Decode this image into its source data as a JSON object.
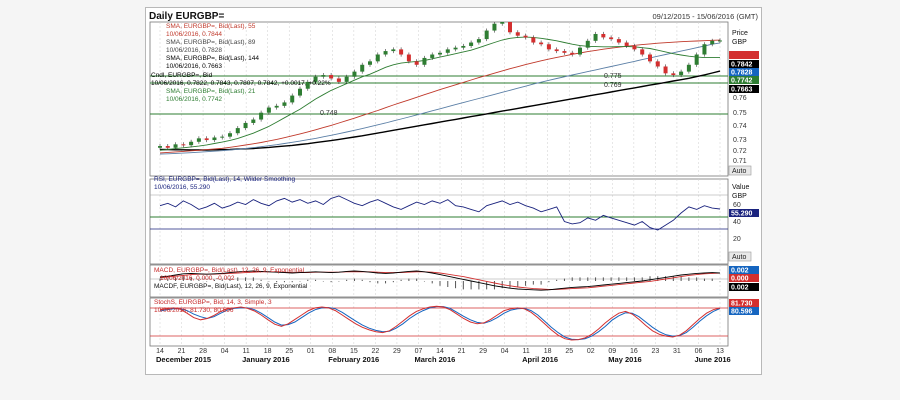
{
  "header": {
    "title": "Daily EURGBP=",
    "date_range": "09/12/2015 - 15/06/2016 (GMT)"
  },
  "price_axis": {
    "title_line1": "Price",
    "title_line2": "GBP",
    "ticks": [
      "0.76",
      "0.75",
      "0.74",
      "0.73",
      "0.72",
      "0.71"
    ],
    "auto": "Auto"
  },
  "value_axis": {
    "title_line1": "Value",
    "title_line2": "GBP",
    "ticks": [
      "60",
      "40",
      "20"
    ],
    "auto": "Auto"
  },
  "price_legend": [
    {
      "text": "SMA, EURGBP=, Bid(Last), 55",
      "color": "#c0392b"
    },
    {
      "text": "10/06/2016, 0.7844",
      "color": "#c0392b"
    },
    {
      "text": "SMA, EURGBP=, Bid(Last), 89",
      "color": "#444444"
    },
    {
      "text": "10/06/2016, 0.7828",
      "color": "#444444"
    },
    {
      "text": "SMA, EURGBP=, Bid(Last), 144",
      "color": "#000000"
    },
    {
      "text": "10/06/2016, 0.7663",
      "color": "#000000"
    },
    {
      "text": "Cndl, EURGBP=, Bid",
      "color": "#000000"
    },
    {
      "text": "10/06/2016, 0.7822, 0.7843, 0.7807, 0.7842, +0.0017, +0.22%",
      "color": "#000000"
    },
    {
      "text": "SMA, EURGBP=, Bid(Last), 21",
      "color": "#2e7d32"
    },
    {
      "text": "10/06/2016, 0.7742",
      "color": "#2e7d32"
    }
  ],
  "price_badges": [
    {
      "text": "0.7842",
      "bg": "#000000",
      "fg": "#ffffff"
    },
    {
      "text": "0.7828",
      "bg": "#1565c0",
      "fg": "#ffffff"
    },
    {
      "text": "0.7742",
      "bg": "#2e7d32",
      "fg": "#ffffff"
    },
    {
      "text": "0.7663",
      "bg": "#000000",
      "fg": "#ffffff"
    }
  ],
  "level_labels": [
    "0.775",
    "0.769",
    "0.748"
  ],
  "rsi": {
    "line1": "RSI, EURGBP=, Bid(Last), 14, Wilder Smoothing",
    "line2": "10/06/2016, 55.290",
    "badge": "55.290"
  },
  "macd": {
    "line1": "MACD, EURGBP=, Bid(Last), 12, 26, 9, Exponential",
    "line2": "10/06/2016, 0.000, -0.002",
    "line3": "MACDF, EURGBP=, Bid(Last), 12, 26, 9, Exponential",
    "badges": [
      {
        "text": "0.002",
        "bg": "#1565c0",
        "fg": "#ffffff"
      },
      {
        "text": "0.000",
        "bg": "#d32f2f",
        "fg": "#ffffff"
      },
      {
        "text": "0.002",
        "bg": "#000000",
        "fg": "#ffffff"
      }
    ]
  },
  "stoch": {
    "line1": "StochS, EURGBP=, Bid, 14, 3, Simple, 3",
    "line2": "10/06/2016, 81.730, 80.596",
    "badges": [
      {
        "text": "81.730",
        "bg": "#d32f2f",
        "fg": "#ffffff"
      },
      {
        "text": "80.596",
        "bg": "#1565c0",
        "fg": "#ffffff"
      }
    ]
  },
  "x_axis": {
    "days": [
      "14",
      "21",
      "28",
      "04",
      "11",
      "18",
      "25",
      "01",
      "08",
      "15",
      "22",
      "29",
      "07",
      "14",
      "21",
      "29",
      "04",
      "11",
      "18",
      "25",
      "02",
      "09",
      "16",
      "23",
      "31",
      "06",
      "13"
    ],
    "months": [
      "December 2015",
      "January 2016",
      "February 2016",
      "March 2016",
      "April 2016",
      "May 2016",
      "June 2016"
    ]
  },
  "colors": {
    "up_candle": "#2e7d32",
    "down_candle": "#d32f2f",
    "sma21": "#2e7d32",
    "sma55": "#c0392b",
    "sma89": "#5b7fa6",
    "sma144": "#000000",
    "rsi": "#1a237e",
    "macd": "#000000",
    "macd_signal": "#d32f2f",
    "stoch_k": "#d32f2f",
    "stoch_d": "#1565c0",
    "grid": "#cfcfcf"
  },
  "chart_data": [
    {
      "type": "candlestick",
      "title": "Daily EURGBP=",
      "y_range": [
        0.705,
        0.795
      ],
      "date_range": [
        "2015-12-09",
        "2016-06-15"
      ],
      "close_values": [
        0.7225,
        0.7215,
        0.7235,
        0.723,
        0.725,
        0.727,
        0.726,
        0.7275,
        0.728,
        0.73,
        0.733,
        0.736,
        0.738,
        0.742,
        0.745,
        0.746,
        0.748,
        0.752,
        0.756,
        0.76,
        0.763,
        0.764,
        0.762,
        0.76,
        0.763,
        0.766,
        0.77,
        0.772,
        0.776,
        0.778,
        0.779,
        0.776,
        0.772,
        0.77,
        0.774,
        0.776,
        0.777,
        0.779,
        0.78,
        0.781,
        0.783,
        0.785,
        0.79,
        0.794,
        0.795,
        0.789,
        0.787,
        0.786,
        0.783,
        0.782,
        0.779,
        0.778,
        0.777,
        0.776,
        0.78,
        0.784,
        0.788,
        0.786,
        0.785,
        0.783,
        0.781,
        0.779,
        0.776,
        0.772,
        0.769,
        0.765,
        0.764,
        0.766,
        0.77,
        0.776,
        0.782,
        0.784,
        0.7842
      ],
      "sma21": [
        0.72,
        0.7205,
        0.721,
        0.7215,
        0.722,
        0.7225,
        0.7232,
        0.724,
        0.7248,
        0.7258,
        0.727,
        0.7285,
        0.73,
        0.732,
        0.734,
        0.7365,
        0.739,
        0.7415,
        0.744,
        0.747,
        0.75,
        0.7525,
        0.755,
        0.757,
        0.759,
        0.761,
        0.763,
        0.7645,
        0.7665,
        0.7685,
        0.77,
        0.771,
        0.7715,
        0.772,
        0.7725,
        0.7735,
        0.7745,
        0.7755,
        0.7765,
        0.7775,
        0.7785,
        0.78,
        0.7815,
        0.783,
        0.7845,
        0.7855,
        0.786,
        0.7862,
        0.786,
        0.7855,
        0.7848,
        0.784,
        0.783,
        0.782,
        0.7812,
        0.7808,
        0.7806,
        0.7805,
        0.7805,
        0.7806,
        0.7806,
        0.7805,
        0.78,
        0.7795,
        0.7785,
        0.7775,
        0.7765,
        0.7757,
        0.775,
        0.7745,
        0.7742,
        0.7742,
        0.7742
      ],
      "sma55": [
        0.7185,
        0.7188,
        0.7191,
        0.7194,
        0.7197,
        0.72,
        0.7204,
        0.7208,
        0.7212,
        0.7218,
        0.7224,
        0.7231,
        0.7238,
        0.7246,
        0.7255,
        0.7264,
        0.7274,
        0.7285,
        0.7296,
        0.7308,
        0.732,
        0.7333,
        0.7346,
        0.736,
        0.7374,
        0.7388,
        0.7403,
        0.7418,
        0.7433,
        0.7449,
        0.7465,
        0.748,
        0.7495,
        0.751,
        0.7525,
        0.754,
        0.7555,
        0.7569,
        0.7583,
        0.7597,
        0.7611,
        0.7625,
        0.7638,
        0.7651,
        0.7664,
        0.7677,
        0.7689,
        0.7701,
        0.7712,
        0.7723,
        0.7733,
        0.7743,
        0.7752,
        0.7761,
        0.7769,
        0.7777,
        0.7784,
        0.7791,
        0.7797,
        0.7803,
        0.7808,
        0.7813,
        0.7818,
        0.7822,
        0.7826,
        0.7829,
        0.7832,
        0.7835,
        0.7837,
        0.7839,
        0.7841,
        0.7843,
        0.7844
      ],
      "sma89": [
        0.7178,
        0.718,
        0.7182,
        0.7184,
        0.7186,
        0.7189,
        0.7192,
        0.7195,
        0.7198,
        0.7202,
        0.7206,
        0.7211,
        0.7216,
        0.7221,
        0.7227,
        0.7233,
        0.724,
        0.7247,
        0.7254,
        0.7262,
        0.727,
        0.7279,
        0.7288,
        0.7297,
        0.7307,
        0.7317,
        0.7327,
        0.7338,
        0.7349,
        0.736,
        0.7372,
        0.7383,
        0.7395,
        0.7407,
        0.7419,
        0.7431,
        0.7443,
        0.7455,
        0.7467,
        0.7479,
        0.7491,
        0.7503,
        0.7515,
        0.7527,
        0.7539,
        0.7551,
        0.7563,
        0.7575,
        0.7587,
        0.7598,
        0.7609,
        0.762,
        0.763,
        0.764,
        0.765,
        0.766,
        0.767,
        0.768,
        0.769,
        0.77,
        0.771,
        0.772,
        0.773,
        0.774,
        0.775,
        0.776,
        0.777,
        0.778,
        0.779,
        0.78,
        0.781,
        0.782,
        0.7828
      ],
      "sma144": [
        0.7205,
        0.7204,
        0.7203,
        0.7203,
        0.7202,
        0.7202,
        0.7202,
        0.7203,
        0.7204,
        0.7205,
        0.7207,
        0.7209,
        0.7211,
        0.7214,
        0.7217,
        0.7221,
        0.7225,
        0.7229,
        0.7234,
        0.7239,
        0.7245,
        0.7251,
        0.7257,
        0.7264,
        0.7271,
        0.7278,
        0.7285,
        0.7293,
        0.7301,
        0.7309,
        0.7317,
        0.7325,
        0.7333,
        0.7341,
        0.7349,
        0.7357,
        0.7365,
        0.7373,
        0.7381,
        0.7389,
        0.7397,
        0.7405,
        0.7413,
        0.7421,
        0.7429,
        0.7437,
        0.7445,
        0.7453,
        0.7461,
        0.7469,
        0.7477,
        0.7485,
        0.7493,
        0.7501,
        0.7509,
        0.7517,
        0.7525,
        0.7533,
        0.7541,
        0.7549,
        0.7557,
        0.7565,
        0.7573,
        0.7581,
        0.7589,
        0.7597,
        0.7605,
        0.7613,
        0.7621,
        0.7631,
        0.7641,
        0.7652,
        0.7663
      ]
    },
    {
      "type": "line",
      "title": "RSI, EURGBP=, Bid(Last), 14, Wilder Smoothing",
      "y_range": [
        10,
        80
      ],
      "values": [
        58,
        60,
        57,
        62,
        59,
        55,
        57,
        60,
        56,
        58,
        61,
        59,
        63,
        60,
        58,
        62,
        64,
        61,
        63,
        60,
        62,
        59,
        64,
        66,
        63,
        60,
        58,
        61,
        63,
        60,
        57,
        55,
        58,
        61,
        59,
        62,
        60,
        63,
        58,
        57,
        55,
        53,
        58,
        60,
        62,
        59,
        61,
        58,
        56,
        53,
        55,
        57,
        45,
        43,
        44,
        48,
        46,
        50,
        48,
        46,
        44,
        42,
        45,
        40,
        38,
        42,
        46,
        52,
        57,
        55,
        58,
        56,
        55.29
      ]
    },
    {
      "type": "line",
      "title": "MACD, EURGBP=, Bid(Last), 12, 26, 9, Exponential",
      "y_range": [
        -0.004,
        0.004
      ],
      "macd": [
        0.001,
        0.0012,
        0.0015,
        0.0018,
        0.0019,
        0.0018,
        0.0017,
        0.0018,
        0.0019,
        0.0021,
        0.0023,
        0.0024,
        0.0025,
        0.0024,
        0.0023,
        0.0022,
        0.0021,
        0.002,
        0.0021,
        0.0022,
        0.0023,
        0.0022,
        0.0021,
        0.0022,
        0.0024,
        0.0025,
        0.0024,
        0.0022,
        0.002,
        0.0019,
        0.002,
        0.0022,
        0.0024,
        0.0025,
        0.0023,
        0.002,
        0.0016,
        0.0012,
        0.0008,
        0.0004,
        0.0,
        -0.0004,
        -0.0008,
        -0.0012,
        -0.0015,
        -0.0018,
        -0.002,
        -0.0021,
        -0.0022,
        -0.0023,
        -0.0022,
        -0.002,
        -0.0018,
        -0.0016,
        -0.0015,
        -0.0014,
        -0.0012,
        -0.001,
        -0.0008,
        -0.0006,
        -0.0004,
        -0.0002,
        0.0,
        0.0003,
        0.0006,
        0.0009,
        0.0012,
        0.0015,
        0.0017,
        0.0019,
        0.002,
        0.0021,
        0.002
      ],
      "signal": [
        0.0008,
        0.001,
        0.0012,
        0.0014,
        0.0016,
        0.0017,
        0.0017,
        0.0017,
        0.0018,
        0.0019,
        0.002,
        0.0021,
        0.0022,
        0.0023,
        0.0023,
        0.0023,
        0.0022,
        0.0021,
        0.0021,
        0.0021,
        0.0022,
        0.0022,
        0.0022,
        0.0022,
        0.0023,
        0.0023,
        0.0023,
        0.0023,
        0.0022,
        0.0021,
        0.0021,
        0.0021,
        0.0022,
        0.0023,
        0.0023,
        0.0022,
        0.002,
        0.0017,
        0.0014,
        0.0011,
        0.0007,
        0.0003,
        -0.0001,
        -0.0005,
        -0.0009,
        -0.0012,
        -0.0015,
        -0.0017,
        -0.0019,
        -0.002,
        -0.0021,
        -0.0021,
        -0.002,
        -0.0019,
        -0.0018,
        -0.0017,
        -0.0015,
        -0.0013,
        -0.0011,
        -0.0009,
        -0.0007,
        -0.0005,
        -0.0003,
        -0.0001,
        0.0002,
        0.0005,
        0.0008,
        0.0011,
        0.0014,
        0.0016,
        0.0018,
        0.0019,
        0.002
      ]
    },
    {
      "type": "line",
      "title": "StochS, EURGBP=, Bid, 14, 3, Simple, 3",
      "y_range": [
        0,
        100
      ],
      "k": [
        78,
        80,
        82,
        79,
        70,
        60,
        55,
        58,
        65,
        74,
        80,
        82,
        84,
        81,
        75,
        66,
        55,
        45,
        40,
        46,
        56,
        66,
        76,
        82,
        84,
        82,
        76,
        66,
        56,
        46,
        38,
        32,
        28,
        26,
        30,
        40,
        52,
        64,
        74,
        80,
        84,
        86,
        84,
        78,
        68,
        58,
        50,
        46,
        48,
        56,
        66,
        76,
        80,
        82,
        80,
        72,
        60,
        46,
        32,
        20,
        12,
        9,
        10,
        14,
        22,
        34,
        48,
        60,
        70,
        74,
        68,
        56,
        42,
        30,
        22,
        18,
        16,
        20,
        30,
        44,
        58,
        70,
        78,
        81.73
      ],
      "d": [
        75,
        78,
        80,
        80,
        76,
        68,
        62,
        58,
        62,
        70,
        77,
        81,
        82,
        82,
        78,
        70,
        60,
        50,
        43,
        44,
        50,
        60,
        70,
        78,
        82,
        83,
        80,
        72,
        62,
        52,
        43,
        36,
        31,
        28,
        29,
        36,
        46,
        58,
        68,
        76,
        82,
        85,
        85,
        81,
        72,
        63,
        55,
        49,
        47,
        52,
        60,
        70,
        77,
        80,
        81,
        76,
        66,
        52,
        38,
        26,
        16,
        11,
        10,
        12,
        18,
        28,
        40,
        54,
        64,
        71,
        70,
        62,
        50,
        38,
        28,
        21,
        18,
        19,
        26,
        38,
        52,
        64,
        74,
        80.596
      ]
    }
  ]
}
